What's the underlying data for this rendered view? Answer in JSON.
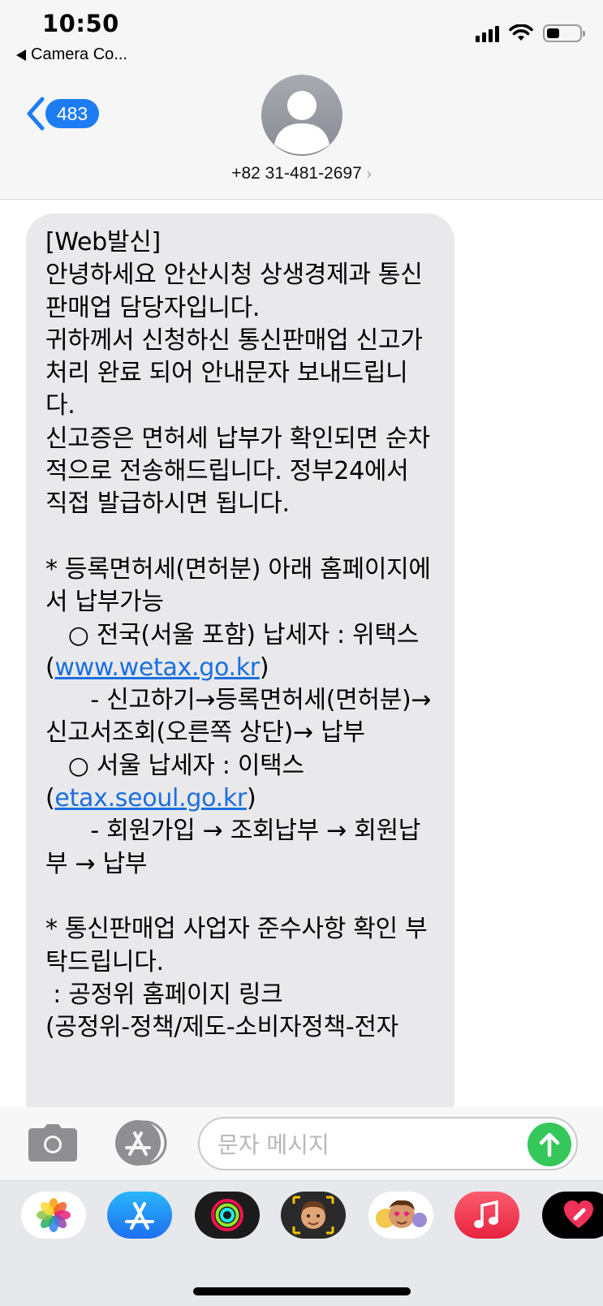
{
  "status_bar": {
    "time": "10:50",
    "back_app": "Camera Co...",
    "battery_level": 0.4
  },
  "header": {
    "unread_count": "483",
    "contact_number": "+82 31-481-2697",
    "contact_chevron": "›"
  },
  "message": {
    "segments": [
      "[Web발신]\n안녕하세요 안산시청 상생경제과 통신판매업 담당자입니다.\n귀하께서 신청하신 통신판매업 신고가 처리 완료 되어 안내문자 보내드립니다.\n신고증은 면허세 납부가 확인되면 순차적으로 전송해드립니다. 정부24에서 직접 발급하시면 됩니다.\n\n* 등록면허세(면허분) 아래 홈페이지에서 납부가능\n   ○ 전국(서울 포함) 납세자 : 위택스\n(",
      "www.wetax.go.kr",
      ")\n      - 신고하기→등록면허세(면허분)→신고서조회(오른쪽 상단)→ 납부\n   ○ 서울 납세자 : 이택스\n(",
      "etax.seoul.go.kr",
      ")\n      - 회원가입 → 조회납부 → 회원납부 → 납부\n\n* 통신판매업 사업자 준수사항 확인 부탁드립니다.\n : 공정위 홈페이지 링크\n(공정위-정책/제도-소비자정책-전자"
    ]
  },
  "input_bar": {
    "placeholder": "문자 메시지",
    "accent_color": "#35c759"
  },
  "app_drawer": {
    "apps": [
      "photos-icon",
      "app-store-icon",
      "activity-icon",
      "memoji-icon",
      "animoji-icon",
      "music-icon",
      "digital-touch-icon"
    ]
  }
}
